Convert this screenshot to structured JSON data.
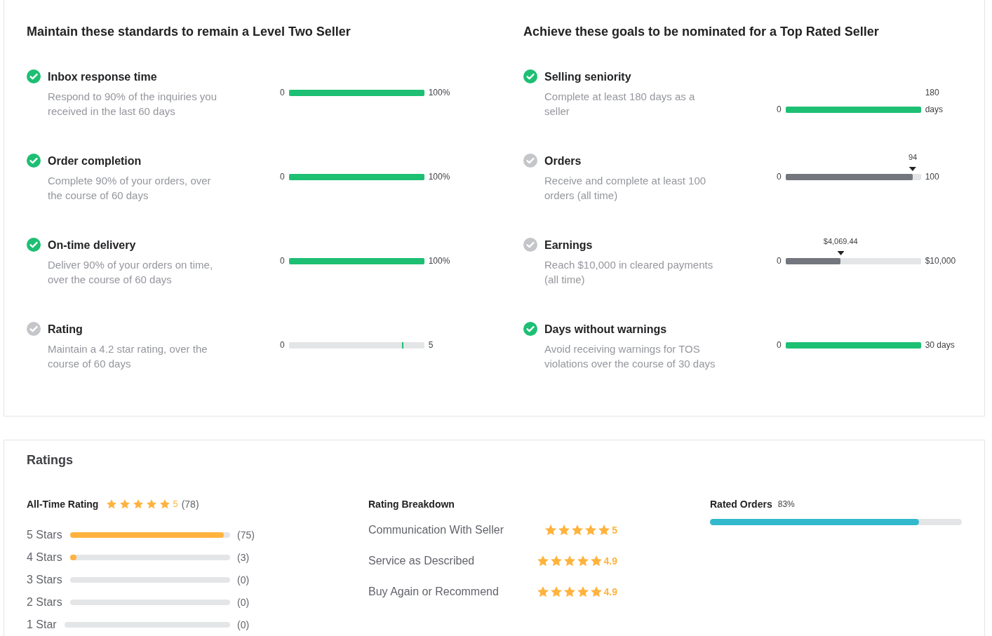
{
  "standards": {
    "title": "Maintain these standards to remain a Level Two Seller",
    "items": [
      {
        "title": "Inbox response time",
        "description": "Respond to 90% of the inquiries you received in the last 60 days",
        "met": true,
        "kind": "fill",
        "level": 1,
        "min": "0",
        "max": "100%"
      },
      {
        "title": "Order completion",
        "description": "Complete 90% of your orders, over the course of 60 days",
        "met": true,
        "kind": "fill",
        "level": 1,
        "min": "0",
        "max": "100%"
      },
      {
        "title": "On-time delivery",
        "description": "Deliver 90% of your orders on time, over the course of 60 days",
        "met": true,
        "kind": "fill",
        "level": 1,
        "min": "0",
        "max": "100%"
      },
      {
        "title": "Rating",
        "description": "Maintain a 4.2 star rating, over the course of 60 days",
        "met": false,
        "kind": "tick",
        "level": 0.84,
        "min": "0",
        "max": "5"
      }
    ]
  },
  "goals": {
    "title": "Achieve these goals to be nominated for a Top Rated Seller",
    "items": [
      {
        "title": "Selling seniority",
        "description": "Complete at least 180 days as a seller",
        "met": true,
        "kind": "fill",
        "level": 1,
        "min": "0",
        "max": "180 days"
      },
      {
        "title": "Orders",
        "description": "Receive and complete at least 100 orders (all time)",
        "met": false,
        "kind": "fill",
        "level": 0.94,
        "marker": "94",
        "min": "0",
        "max": "100"
      },
      {
        "title": "Earnings",
        "description": "Reach $10,000 in cleared payments (all time)",
        "met": false,
        "kind": "fill",
        "level": 0.407,
        "marker": "$4,069.44",
        "min": "0",
        "max": "$10,000"
      },
      {
        "title": "Days without warnings",
        "description": "Avoid receiving warnings for TOS violations over the course of 30 days",
        "met": true,
        "kind": "fill",
        "level": 1,
        "min": "0",
        "max": "30 days"
      }
    ]
  },
  "ratings": {
    "title": "Ratings",
    "all_time": {
      "label": "All-Time Rating",
      "stars": 5,
      "score": "5",
      "count": "(78)"
    },
    "histogram": [
      {
        "label": "5 Stars",
        "level": 0.96,
        "count": "(75)"
      },
      {
        "label": "4 Stars",
        "level": 0.04,
        "count": "(3)"
      },
      {
        "label": "3 Stars",
        "count": "(0)"
      },
      {
        "label": "2 Stars",
        "count": "(0)"
      },
      {
        "label": "1 Star",
        "count": "(0)"
      }
    ],
    "breakdown": {
      "title": "Rating Breakdown",
      "items": [
        {
          "label": "Communication With Seller",
          "stars": 5,
          "score": "5"
        },
        {
          "label": "Service as Described",
          "stars": 5,
          "score": "4.9"
        },
        {
          "label": "Buy Again or Recommend",
          "stars": 5,
          "score": "4.9"
        }
      ]
    },
    "rated_orders": {
      "label": "Rated Orders",
      "value": "83%",
      "level": 0.83
    }
  }
}
